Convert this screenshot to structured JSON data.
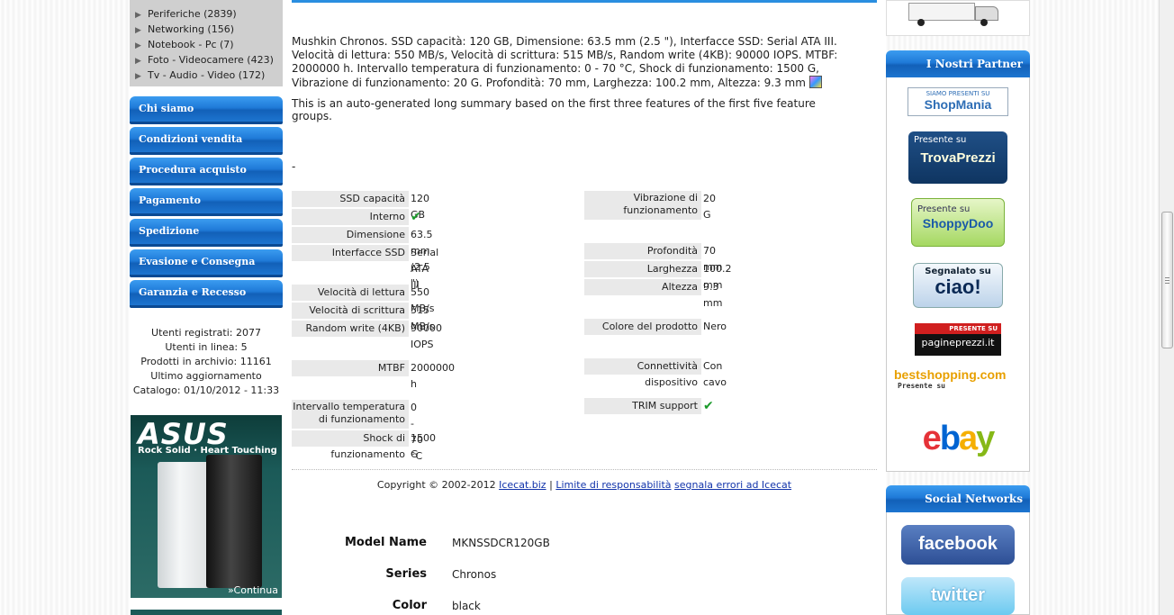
{
  "categories": [
    {
      "label": "Periferiche (2839)"
    },
    {
      "label": "Networking (156)"
    },
    {
      "label": "Notebook - Pc (7)"
    },
    {
      "label": "Foto - Videocamere (423)"
    },
    {
      "label": "Tv - Audio - Video (172)"
    }
  ],
  "nav": [
    {
      "label": "Chi siamo"
    },
    {
      "label": "Condizioni vendita"
    },
    {
      "label": "Procedura acquisto"
    },
    {
      "label": "Pagamento"
    },
    {
      "label": "Spedizione"
    },
    {
      "label": "Evasione e Consegna"
    },
    {
      "label": "Garanzia e Recesso"
    }
  ],
  "stats": {
    "registered": "Utenti registrati: 2077",
    "online": "Utenti in linea: 5",
    "products": "Prodotti in archivio: 11161",
    "updated": "Ultimo aggiornamento",
    "catalog": "Catalogo: 01/10/2012 - 11:33"
  },
  "asus_banner": {
    "logo": "ASUS",
    "tagline": "Rock Solid · Heart Touching",
    "more": "»Continua"
  },
  "description": {
    "text": "Mushkin Chronos. SSD capacità: 120 GB, Dimensione: 63.5 mm (2.5 \"), Interfacce SSD: Serial ATA III. Velocità di lettura: 550 MB/s, Velocità di scrittura: 515 MB/s, Random write (4KB): 90000 IOPS. MTBF: 2000000 h. Intervallo temperatura di funzionamento: 0 - 70 °C, Shock di funzionamento: 1500 G, Vibrazione di funzionamento: 20 G. Profondità: 70 mm, Larghezza: 100.2 mm, Altezza: 9.3 mm",
    "summary": "This is an auto-generated long summary based on the first three features of the first five feature groups.",
    "dash": "-"
  },
  "specs_left": [
    {
      "label": "SSD capacità",
      "value": "120 GB"
    },
    {
      "label": "Interno",
      "value": "✔"
    },
    {
      "label": "Dimensione",
      "value": "63.5 mm (2.5 \")"
    },
    {
      "label": "Interfacce SSD",
      "value": "Serial ATA III"
    },
    {
      "label": "Velocità di lettura",
      "value": "550 MB/s"
    },
    {
      "label": "Velocità di scrittura",
      "value": "515 MB/s"
    },
    {
      "label": "Random write (4KB)",
      "value": "90000 IOPS"
    },
    {
      "label": "MTBF",
      "value": "2000000 h"
    },
    {
      "label": "Intervallo temperatura di funzionamento",
      "value": "0 - 70 °C"
    },
    {
      "label": "Shock di funzionamento",
      "value": "1500 G"
    }
  ],
  "specs_right": [
    {
      "label": "Vibrazione di funzionamento",
      "value": "20 G"
    },
    {
      "label": "Profondità",
      "value": "70 mm"
    },
    {
      "label": "Larghezza",
      "value": "100.2 mm"
    },
    {
      "label": "Altezza",
      "value": "9.3 mm"
    },
    {
      "label": "Colore del prodotto",
      "value": "Nero"
    },
    {
      "label": "Connettività dispositivo",
      "value": "Con cavo"
    },
    {
      "label": "TRIM support",
      "value": "✔"
    }
  ],
  "footer": {
    "copyright": "Copyright © 2002-2012",
    "link_icecat": "Icecat.biz",
    "sep": "|",
    "link_limits": "Limite di responsabilità",
    "link_errors": "segnala errori ad Icecat"
  },
  "details": [
    {
      "label": "Model Name",
      "value": "MKNSSDCR120GB"
    },
    {
      "label": "Series",
      "value": "Chronos"
    },
    {
      "label": "Color",
      "value": "black"
    }
  ],
  "right": {
    "partners_title": "I Nostri Partner",
    "social_title": "Social Networks",
    "shopmania_top": "SIAMO PRESENTI SU",
    "shopmania": "ShopMania",
    "trovaprezzi_top": "Presente su",
    "trovaprezzi": "TrovaPrezzi",
    "shoppydoo_top": "Presente su",
    "shoppydoo": "ShoppyDoo",
    "ciao_top": "Segnalato su",
    "ciao": "ciao!",
    "pagine_top": "PRESENTE SU",
    "pagine": "pagineprezzi.it",
    "bestshopping": "bestshopping.com",
    "bestshopping_sub": "Presente su",
    "ebay": "ebay",
    "facebook": "facebook",
    "twitter": "twitter"
  },
  "colors": {
    "nav_blue": "#1f7ad8",
    "check_green": "#1a9a2a",
    "link_blue": "#1133aa"
  }
}
